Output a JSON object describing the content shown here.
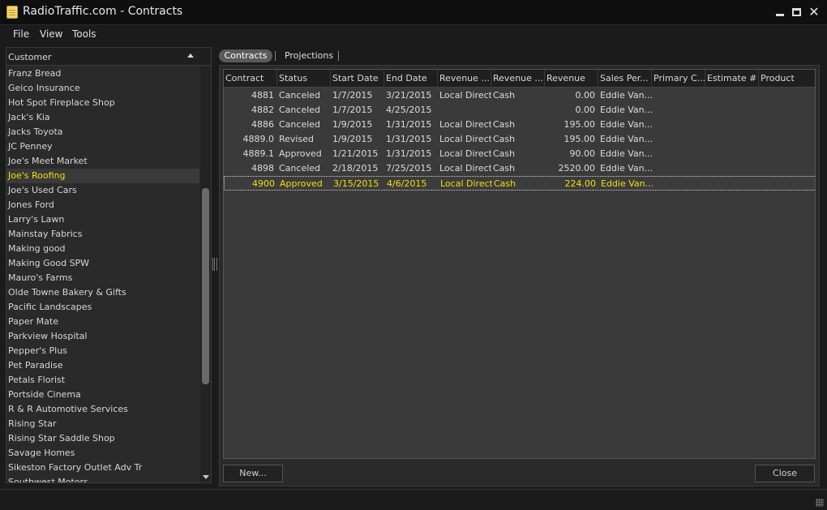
{
  "window": {
    "title": "RadioTraffic.com - Contracts",
    "icons": {
      "app": "notepad-icon",
      "minimize": "minimize-icon",
      "maximize": "maximize-icon",
      "close": "close-icon"
    }
  },
  "menu": [
    "File",
    "View",
    "Tools"
  ],
  "customers": {
    "header": "Customer",
    "sort_icon": "sort-ascending-icon",
    "items": [
      "Franz Bread",
      "Geico Insurance",
      "Hot Spot Fireplace Shop",
      "Jack's Kia",
      "Jacks Toyota",
      "JC Penney",
      "Joe's Meet Market",
      "Joe's Roofing",
      "Joe's Used Cars",
      "Jones Ford",
      "Larry's Lawn",
      "Mainstay Fabrics",
      "Making good",
      "Making Good SPW",
      "Mauro's Farms",
      "Olde Towne Bakery & Gifts",
      "Pacific Landscapes",
      "Paper Mate",
      "Parkview Hospital",
      "Pepper's Plus",
      "Pet Paradise",
      "Petals Florist",
      "Portside Cinema",
      "R & R Automotive Services",
      "Rising Star",
      "Rising Star Saddle Shop",
      "Savage Homes",
      "Sikeston Factory Outlet Adv Tr",
      "Southwest Motors"
    ],
    "selected": "Joe's Roofing"
  },
  "tabs": [
    {
      "label": "Contracts",
      "active": true
    },
    {
      "label": "Projections",
      "active": false
    }
  ],
  "grid": {
    "columns": [
      "Contract",
      "Status",
      "Start Date",
      "End Date",
      "Revenue ...",
      "Revenue ...",
      "Revenue",
      "Sales Per...",
      "Primary C...",
      "Estimate #",
      "Product"
    ],
    "rows": [
      [
        "4881",
        "Canceled",
        "1/7/2015",
        "3/21/2015",
        "Local Direct",
        "Cash",
        "0.00",
        "Eddie Van...",
        "",
        "",
        ""
      ],
      [
        "4882",
        "Canceled",
        "1/7/2015",
        "4/25/2015",
        "",
        "",
        "0.00",
        "Eddie Van...",
        "",
        "",
        ""
      ],
      [
        "4886",
        "Canceled",
        "1/9/2015",
        "1/31/2015",
        "Local Direct",
        "Cash",
        "195.00",
        "Eddie Van...",
        "",
        "",
        ""
      ],
      [
        "4889.0",
        "Revised",
        "1/9/2015",
        "1/31/2015",
        "Local Direct",
        "Cash",
        "195.00",
        "Eddie Van...",
        "",
        "",
        ""
      ],
      [
        "4889.1",
        "Approved",
        "1/21/2015",
        "1/31/2015",
        "Local Direct",
        "Cash",
        "90.00",
        "Eddie Van...",
        "",
        "",
        ""
      ],
      [
        "4898",
        "Canceled",
        "2/18/2015",
        "7/25/2015",
        "Local Direct",
        "Cash",
        "2520.00",
        "Eddie Van...",
        "",
        "",
        ""
      ],
      [
        "4900",
        "Approved",
        "3/15/2015",
        "4/6/2015",
        "Local Direct",
        "Cash",
        "224.00",
        "Eddie Van...",
        "",
        "",
        ""
      ]
    ],
    "selected_row": 6
  },
  "buttons": {
    "new": "New...",
    "close": "Close"
  },
  "colors": {
    "selection_text": "#f0e000",
    "background": "#2a2a2a"
  }
}
